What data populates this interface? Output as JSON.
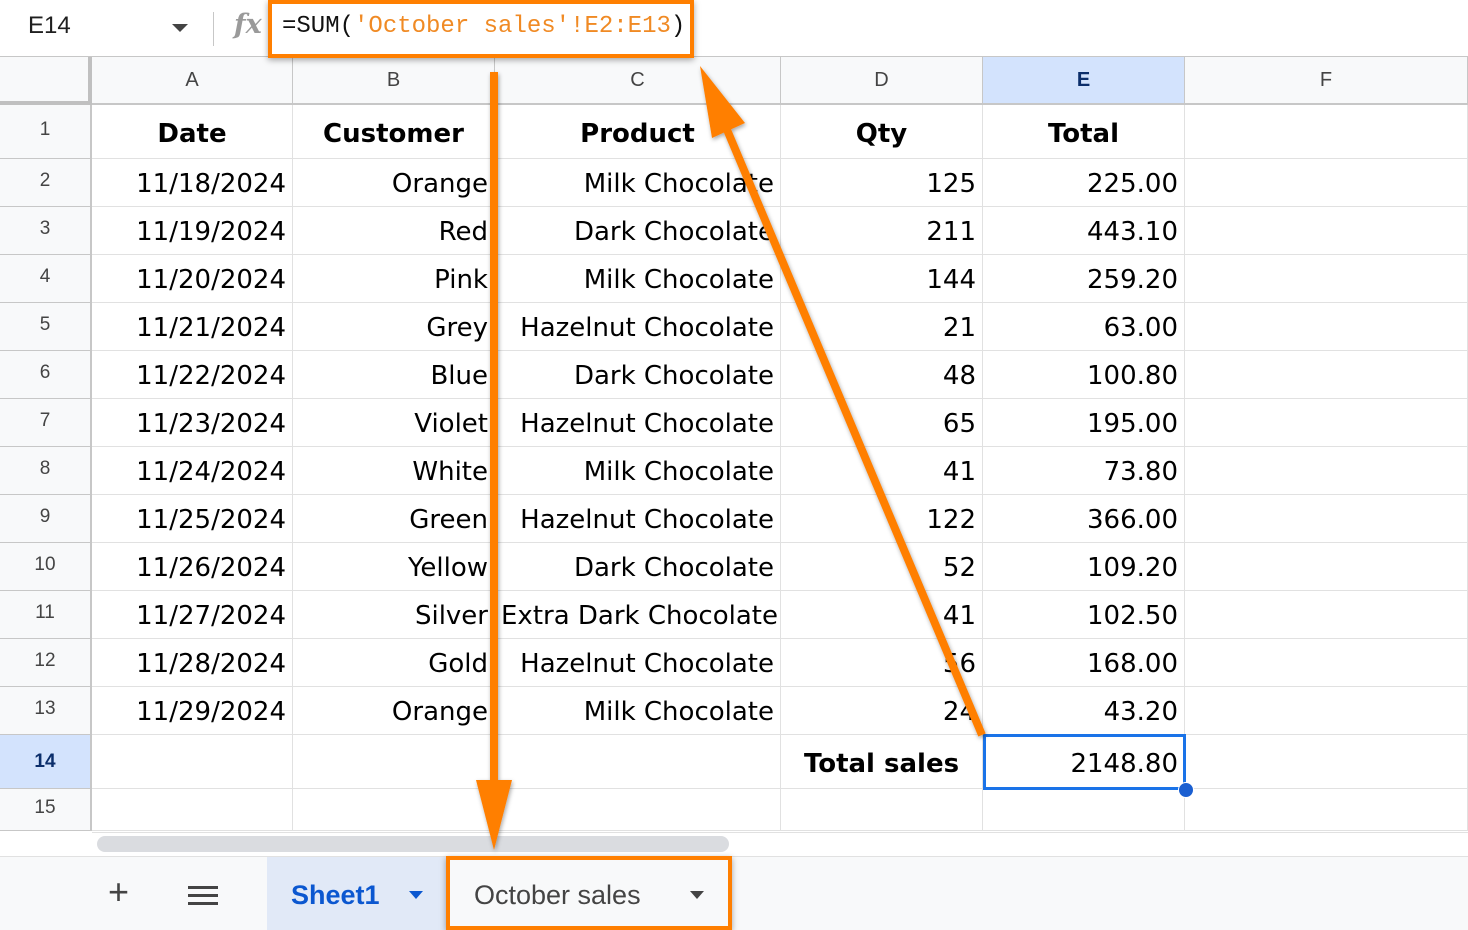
{
  "formula_bar": {
    "name_box": "E14",
    "fx_label": "fx",
    "formula_prefix": "=SUM(",
    "formula_ref": "'October sales'!E2:E13",
    "formula_suffix": ")"
  },
  "columns": [
    "A",
    "B",
    "C",
    "D",
    "E",
    "F"
  ],
  "selected_column": "E",
  "rows": [
    "1",
    "2",
    "3",
    "4",
    "5",
    "6",
    "7",
    "8",
    "9",
    "10",
    "11",
    "12",
    "13",
    "14",
    "15"
  ],
  "selected_row": "14",
  "headers": {
    "date": "Date",
    "customer": "Customer",
    "product": "Product",
    "qty": "Qty",
    "total": "Total"
  },
  "data": [
    {
      "date": "11/18/2024",
      "customer": "Orange",
      "product": "Milk Chocolate",
      "qty": "125",
      "total": "225.00"
    },
    {
      "date": "11/19/2024",
      "customer": "Red",
      "product": "Dark Chocolate",
      "qty": "211",
      "total": "443.10"
    },
    {
      "date": "11/20/2024",
      "customer": "Pink",
      "product": "Milk Chocolate",
      "qty": "144",
      "total": "259.20"
    },
    {
      "date": "11/21/2024",
      "customer": "Grey",
      "product": "Hazelnut Chocolate",
      "qty": "21",
      "total": "63.00"
    },
    {
      "date": "11/22/2024",
      "customer": "Blue",
      "product": "Dark Chocolate",
      "qty": "48",
      "total": "100.80"
    },
    {
      "date": "11/23/2024",
      "customer": "Violet",
      "product": "Hazelnut Chocolate",
      "qty": "65",
      "total": "195.00"
    },
    {
      "date": "11/24/2024",
      "customer": "White",
      "product": "Milk Chocolate",
      "qty": "41",
      "total": "73.80"
    },
    {
      "date": "11/25/2024",
      "customer": "Green",
      "product": "Hazelnut Chocolate",
      "qty": "122",
      "total": "366.00"
    },
    {
      "date": "11/26/2024",
      "customer": "Yellow",
      "product": "Dark Chocolate",
      "qty": "52",
      "total": "109.20"
    },
    {
      "date": "11/27/2024",
      "customer": "Silver",
      "product": "Extra Dark Chocolate",
      "qty": "41",
      "total": "102.50"
    },
    {
      "date": "11/28/2024",
      "customer": "Gold",
      "product": "Hazelnut Chocolate",
      "qty": "56",
      "total": "168.00"
    },
    {
      "date": "11/29/2024",
      "customer": "Orange",
      "product": "Milk Chocolate",
      "qty": "24",
      "total": "43.20"
    }
  ],
  "summary": {
    "label": "Total sales",
    "value": "2148.80"
  },
  "sheet_tabs": {
    "add_label": "+",
    "tabs": [
      {
        "label": "Sheet1",
        "active": true
      },
      {
        "label": "October sales",
        "active": false
      }
    ]
  },
  "annotation_color": "#ff7f00",
  "selection_color": "#1a73e8"
}
